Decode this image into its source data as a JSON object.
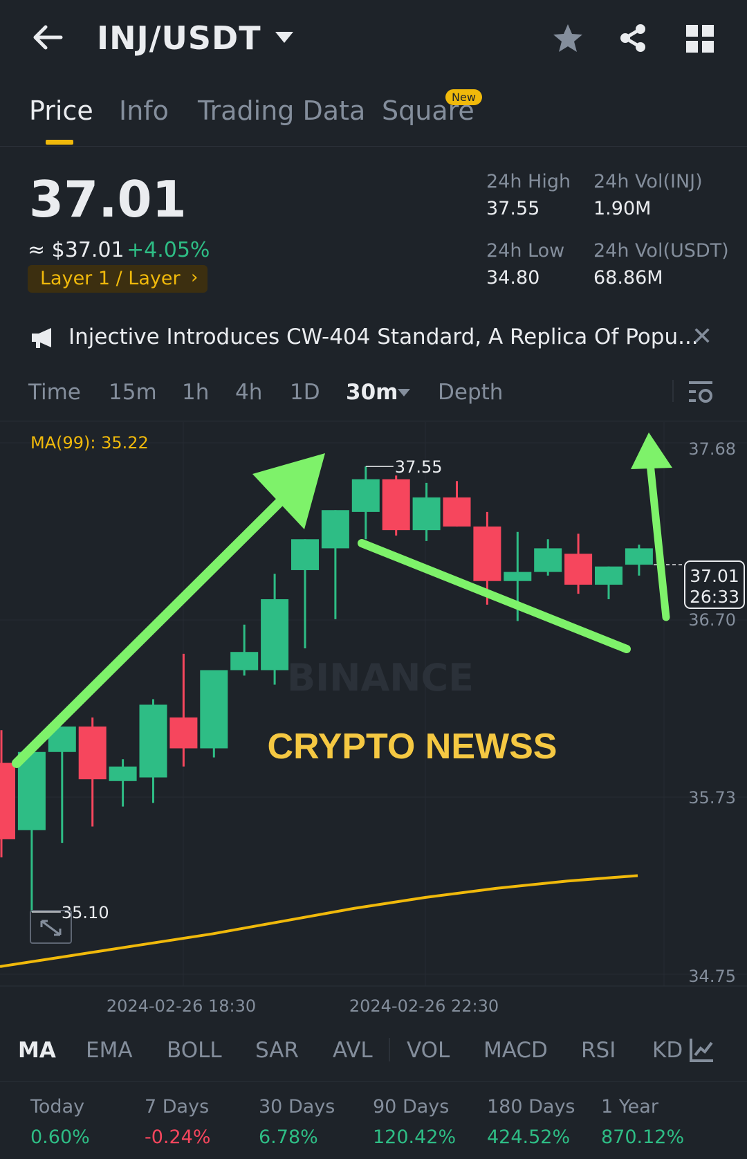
{
  "header": {
    "pair": "INJ/USDT",
    "icons": [
      "back-arrow-icon",
      "caret-down-icon",
      "star-icon",
      "share-icon",
      "grid-icon"
    ]
  },
  "tabs": [
    {
      "label": "Price",
      "active": true
    },
    {
      "label": "Info",
      "active": false
    },
    {
      "label": "Trading Data",
      "active": false
    },
    {
      "label": "Square",
      "active": false,
      "badge": "New"
    }
  ],
  "price": {
    "last": "37.01",
    "approx": "≈ $37.01",
    "change": "+4.05%",
    "sector": "Layer 1 / Layer"
  },
  "stats": {
    "high_label": "24h High",
    "high_value": "37.55",
    "low_label": "24h Low",
    "low_value": "34.80",
    "vol_inj_label": "24h Vol(INJ)",
    "vol_inj_value": "1.90M",
    "vol_usdt_label": "24h Vol(USDT)",
    "vol_usdt_value": "68.86M"
  },
  "news": {
    "text": "Injective Introduces CW-404 Standard, A Replica Of Popu..."
  },
  "intervals": [
    {
      "label": "Time"
    },
    {
      "label": "15m"
    },
    {
      "label": "1h"
    },
    {
      "label": "4h"
    },
    {
      "label": "1D"
    },
    {
      "label": "30m",
      "selected": true
    },
    {
      "label": "Depth"
    }
  ],
  "chart_data": {
    "type": "candlestick",
    "indicator_label": "MA(99): 35.22",
    "price_ticks": [
      "37.68",
      "36.70",
      "35.73",
      "34.75"
    ],
    "ylim": [
      34.75,
      37.68
    ],
    "time_labels": [
      "2024-02-26 18:30",
      "2024-02-26 22:30"
    ],
    "watermark": "BINANCE",
    "overlay_text": "CRYPTO NEWSS",
    "high_marker": "37.55",
    "low_marker": "35.10",
    "current_price": "37.01",
    "countdown": "26:33",
    "up_color": "#2ebd85",
    "down_color": "#f6465d",
    "ma_color": "#f0b90b",
    "annotation_color": "#7ef26a",
    "candles": [
      {
        "o": 35.92,
        "h": 36.1,
        "l": 35.4,
        "c": 35.5
      },
      {
        "o": 35.55,
        "h": 36.0,
        "l": 35.1,
        "c": 35.98
      },
      {
        "o": 35.98,
        "h": 36.1,
        "l": 35.48,
        "c": 36.12
      },
      {
        "o": 36.12,
        "h": 36.17,
        "l": 35.57,
        "c": 35.83
      },
      {
        "o": 35.82,
        "h": 35.94,
        "l": 35.68,
        "c": 35.9
      },
      {
        "o": 35.84,
        "h": 36.27,
        "l": 35.7,
        "c": 36.24
      },
      {
        "o": 36.17,
        "h": 36.52,
        "l": 35.9,
        "c": 36.0
      },
      {
        "o": 36.0,
        "h": 36.43,
        "l": 35.95,
        "c": 36.43
      },
      {
        "o": 36.43,
        "h": 36.68,
        "l": 36.4,
        "c": 36.53
      },
      {
        "o": 36.43,
        "h": 36.96,
        "l": 36.35,
        "c": 36.82
      },
      {
        "o": 36.98,
        "h": 37.15,
        "l": 36.55,
        "c": 37.15
      },
      {
        "o": 37.1,
        "h": 37.31,
        "l": 36.71,
        "c": 37.31
      },
      {
        "o": 37.3,
        "h": 37.55,
        "l": 37.15,
        "c": 37.48
      },
      {
        "o": 37.48,
        "h": 37.5,
        "l": 37.17,
        "c": 37.2
      },
      {
        "o": 37.2,
        "h": 37.46,
        "l": 37.14,
        "c": 37.38
      },
      {
        "o": 37.38,
        "h": 37.47,
        "l": 37.22,
        "c": 37.22
      },
      {
        "o": 37.22,
        "h": 37.3,
        "l": 36.79,
        "c": 36.92
      },
      {
        "o": 36.92,
        "h": 37.19,
        "l": 36.7,
        "c": 36.97
      },
      {
        "o": 36.97,
        "h": 37.15,
        "l": 36.95,
        "c": 37.1
      },
      {
        "o": 37.07,
        "h": 37.18,
        "l": 36.85,
        "c": 36.9
      },
      {
        "o": 36.9,
        "h": 37.0,
        "l": 36.82,
        "c": 37.0
      },
      {
        "o": 37.01,
        "h": 37.12,
        "l": 36.95,
        "c": 37.1
      }
    ],
    "ma_line": [
      34.8,
      34.86,
      34.92,
      34.98,
      35.05,
      35.12,
      35.18,
      35.23,
      35.27,
      35.3
    ]
  },
  "indicators": [
    {
      "label": "MA",
      "active": true
    },
    {
      "label": "EMA"
    },
    {
      "label": "BOLL"
    },
    {
      "label": "SAR"
    },
    {
      "label": "AVL"
    },
    {
      "label": "VOL"
    },
    {
      "label": "MACD"
    },
    {
      "label": "RSI"
    },
    {
      "label": "KD"
    }
  ],
  "performance": [
    {
      "label": "Today",
      "value": "0.60%",
      "color": "#2ebd85"
    },
    {
      "label": "7 Days",
      "value": "-0.24%",
      "color": "#f6465d"
    },
    {
      "label": "30 Days",
      "value": "6.78%",
      "color": "#2ebd85"
    },
    {
      "label": "90 Days",
      "value": "120.42%",
      "color": "#2ebd85"
    },
    {
      "label": "180 Days",
      "value": "424.52%",
      "color": "#2ebd85"
    },
    {
      "label": "1 Year",
      "value": "870.12%",
      "color": "#2ebd85"
    }
  ]
}
